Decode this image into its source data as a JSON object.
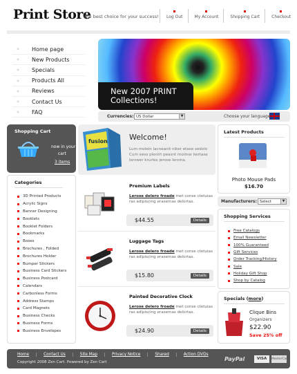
{
  "header": {
    "logo": "Print Store",
    "tagline": "the best choice for your success!",
    "nav": [
      "Log Out",
      "My Account",
      "Shopping Cart",
      "Checkout"
    ]
  },
  "menu": [
    "Home page",
    "New Products",
    "Specials",
    "Products All",
    "Reviews",
    "Contact Us",
    "FAQ"
  ],
  "banner": {
    "line1": "New 2007 PRINT",
    "line2": "Collections!"
  },
  "currency": {
    "label": "Currencies:",
    "value": "US Dollar"
  },
  "language": {
    "label": "Choose your language:"
  },
  "cart": {
    "title": "Shopping Cart",
    "line1": "now in your",
    "line2": "cart",
    "items": "3 items"
  },
  "categories": {
    "title": "Categories",
    "items": [
      "3D Printed Products",
      "Acrylic Signs",
      "Banner Designing",
      "Booklets",
      "Booklet Folders",
      "Bookmarks",
      "Boxes",
      "Brochures , Folded",
      "Brochures Holder",
      "Bumper Stickers",
      "Business Card Stickers",
      "Business Postcard",
      "Calendars",
      "Carbonless Forms",
      "Address Stamps",
      "Card Magnets",
      "Business Checks",
      "Business Forms",
      "Business Envelopes"
    ]
  },
  "welcome": {
    "title": "Welcome!",
    "text": "Lum molein lacneanit niker etase sedolo Cum seso plenlrt peasnt moilner kertase lerswer krurles jerose lersina."
  },
  "products": [
    {
      "title": "Premium Labels",
      "lead": "Lerose delero froade",
      "desc": "met conse ctetuias ras adipiscing erasemas delortas.",
      "price": "$44.55",
      "details": "Details"
    },
    {
      "title": "Luggage Tags",
      "lead": "Lerose delero froade",
      "desc": "met conse ctetuias ras adipiscing erasemas delortas.",
      "price": "$15.80",
      "details": "Details"
    },
    {
      "title": "Painted Decorative Clock",
      "lead": "Lerose delero froade",
      "desc": "met conse ctetuias ras adipiscing erasemas delortas.",
      "price": "$24.90",
      "details": "Details"
    }
  ],
  "latest": {
    "title": "Latest Products",
    "name": "Photo Mouse Pads",
    "price": "$16.70"
  },
  "manufacturers": {
    "label": "Manufacturers:",
    "value": "Select"
  },
  "services": {
    "title": "Shopping Services",
    "items": [
      "Free Catalogs",
      "Email Newsletter",
      "100% Guaranteed",
      "Gift Services",
      "Order Tracking/History",
      "Sale",
      "Holiday Gift Shop",
      "Shop by Catalog"
    ]
  },
  "specials": {
    "title": "Specials",
    "more": "more",
    "name": "Clique Bins",
    "sub": "Organizers",
    "price": "$22.90",
    "save": "Save 25% off"
  },
  "footer": {
    "links": [
      "Home",
      "Contact Us",
      "Site Map",
      "Privacy Notice",
      "Shared",
      "Action DVDs"
    ],
    "copyright": "Copyright 2008 Zen Cart. Powered by Zen Cart",
    "paypal": "PayPal",
    "visa": "VISA",
    "mastercard": "MasterCard"
  }
}
